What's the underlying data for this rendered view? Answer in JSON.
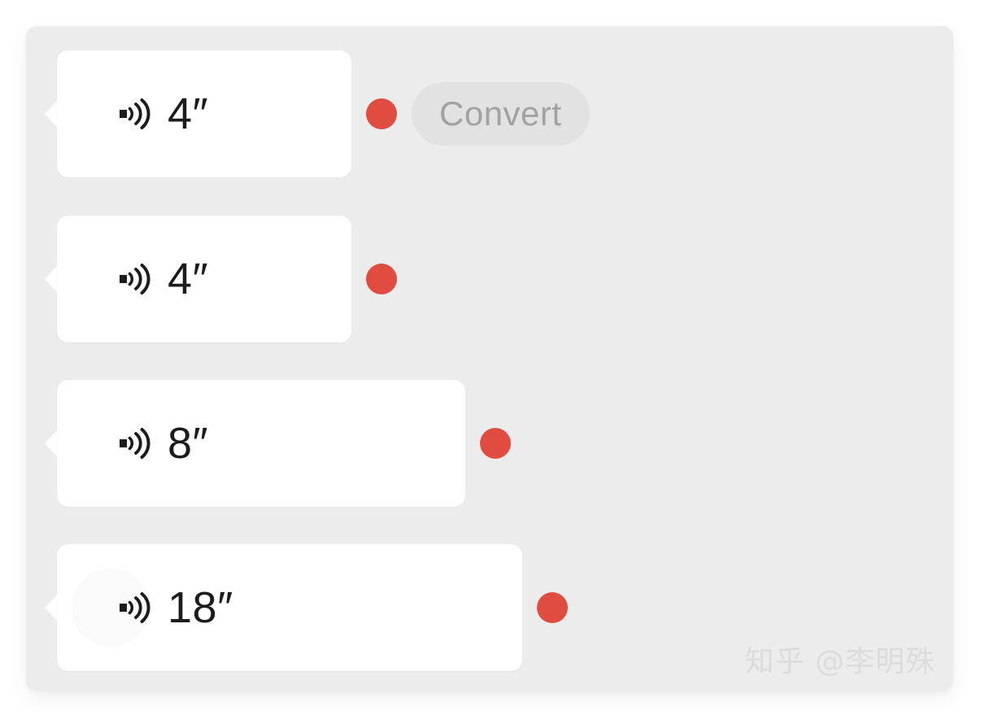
{
  "app": {
    "type": "voice-message-list",
    "panel_background": "#ececec",
    "bubble_background": "#ffffff",
    "accent_unread": "#e04c40",
    "text_color": "#1c1c1c"
  },
  "messages": [
    {
      "id": "msg-1",
      "icon": "sound-wave-icon",
      "duration": "4″",
      "unread": true,
      "width_class": "bubble-w1",
      "has_convert": true,
      "has_ripple": false
    },
    {
      "id": "msg-2",
      "icon": "sound-wave-icon",
      "duration": "4″",
      "unread": true,
      "width_class": "bubble-w2",
      "has_convert": false,
      "has_ripple": false
    },
    {
      "id": "msg-3",
      "icon": "sound-wave-icon",
      "duration": "8″",
      "unread": true,
      "width_class": "bubble-w3",
      "has_convert": false,
      "has_ripple": false
    },
    {
      "id": "msg-4",
      "icon": "sound-wave-icon",
      "duration": "18″",
      "unread": true,
      "width_class": "bubble-w4",
      "has_convert": false,
      "has_ripple": true
    }
  ],
  "convert_button": {
    "label": "Convert",
    "background": "#e2e2e2",
    "text_color": "#a2a2a2"
  },
  "watermark": {
    "text": "知乎 @李明殊",
    "color": "#dcdcdc"
  }
}
